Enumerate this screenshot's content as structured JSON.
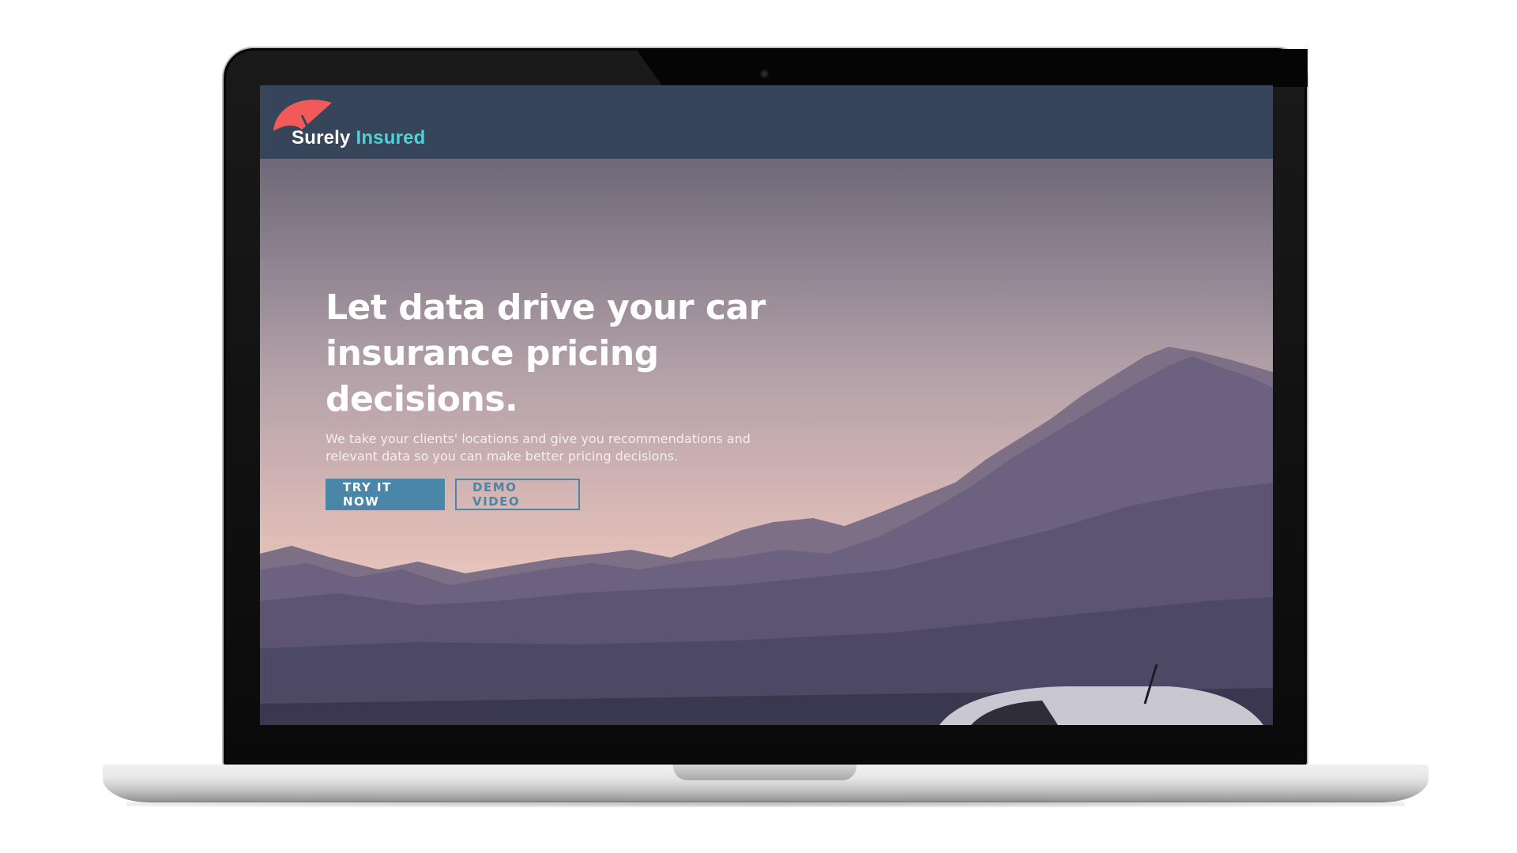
{
  "brand": {
    "name_part1": "Surely",
    "name_part2": "Insured",
    "logo_icon": "umbrella-icon",
    "colors": {
      "umbrella": "#f25a5a",
      "accent": "#4fd1d9",
      "navbar": "#36455a",
      "button": "#4a86a8"
    }
  },
  "hero": {
    "headline": "Let data drive your car insurance pricing decisions.",
    "subtext": "We take your clients' locations and give you recommendations and relevant data so you can make better pricing decisions.",
    "primary_button": "TRY IT NOW",
    "secondary_button": "DEMO VIDEO"
  }
}
